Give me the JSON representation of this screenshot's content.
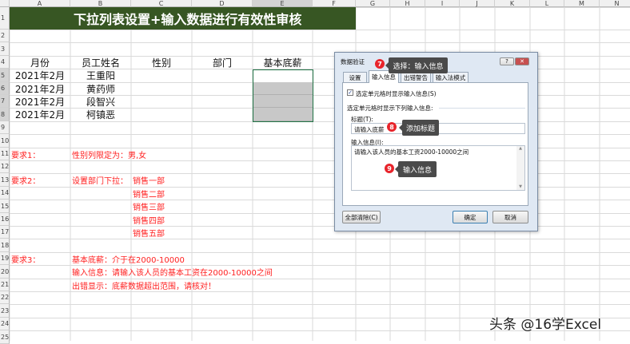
{
  "columns": [
    "A",
    "B",
    "C",
    "D",
    "E",
    "F",
    "G",
    "H",
    "I",
    "J",
    "K",
    "L",
    "M",
    "N"
  ],
  "rows": [
    "1",
    "2",
    "3",
    "4",
    "5",
    "6",
    "7",
    "8",
    "9",
    "10",
    "11",
    "12",
    "13",
    "14",
    "15",
    "16",
    "17",
    "18",
    "19",
    "20",
    "21",
    "22",
    "23",
    "24",
    "25"
  ],
  "sheet": {
    "title": "下拉列表设置+输入数据进行有效性审核",
    "headers": [
      "月份",
      "员工姓名",
      "性别",
      "部门",
      "基本底薪"
    ],
    "records": [
      {
        "month": "2021年2月",
        "name": "王重阳"
      },
      {
        "month": "2021年2月",
        "name": "黄药师"
      },
      {
        "month": "2021年2月",
        "name": "段智兴"
      },
      {
        "month": "2021年2月",
        "name": "柯镇恶"
      }
    ],
    "req1_label": "要求1：",
    "req1_text": "性别列限定为：男,女",
    "req2_label": "要求2：",
    "req2_text": "设置部门下拉：",
    "departments": [
      "销售一部",
      "销售二部",
      "销售三部",
      "销售四部",
      "销售五部"
    ],
    "req3_label": "要求3：",
    "req3_lines": [
      "基本底薪：介于在2000-10000",
      "输入信息：请输入该人员的基本工资在2000-10000之间",
      "出错显示：底薪数据超出范围，请核对！"
    ]
  },
  "dialog": {
    "title": "数据验证",
    "help": "?",
    "close": "✕",
    "tabs": [
      "设置",
      "输入信息",
      "出错警告",
      "输入法模式"
    ],
    "active_tab": "输入信息",
    "checkbox_label": "选定单元格时显示输入信息(S)",
    "checkbox_checked": true,
    "section_label": "选定单元格时显示下列输入信息:",
    "title_label": "标题(T):",
    "title_value": "请输入底薪",
    "message_label": "输入信息(I):",
    "message_value": "请输入该人员的基本工资2000-10000之间",
    "clear_all": "全部清除(C)",
    "ok": "确定",
    "cancel": "取消"
  },
  "callouts": [
    {
      "num": "7",
      "text": "选择：输入信息"
    },
    {
      "num": "8",
      "text": "添加标题"
    },
    {
      "num": "9",
      "text": "输入信息"
    }
  ],
  "watermark": "头条 @16学Excel",
  "colors": {
    "title_bg": "#375623",
    "accent_red": "#ff2020",
    "badge": "#e8242b"
  }
}
